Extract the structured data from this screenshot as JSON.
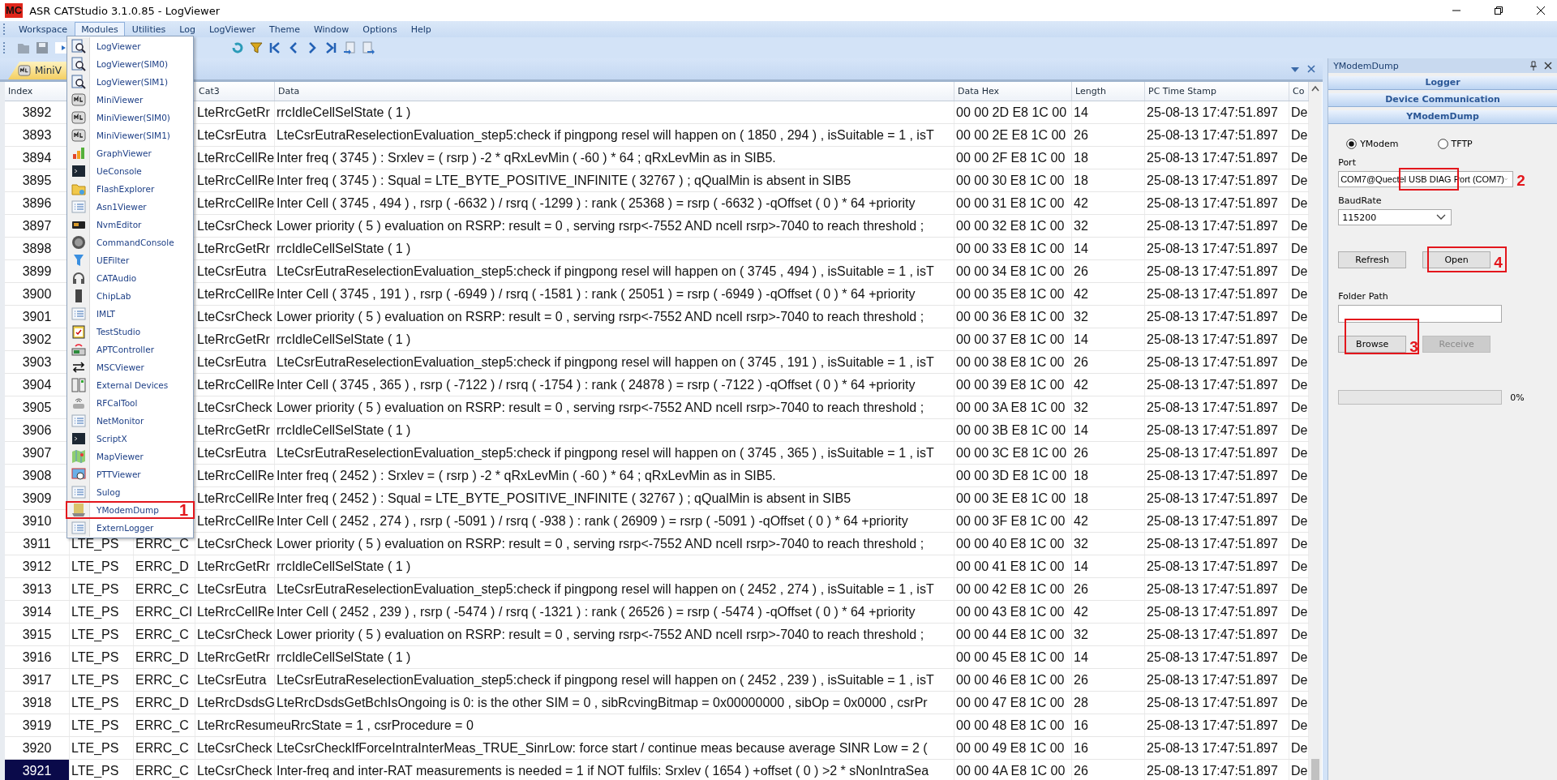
{
  "window": {
    "logo": "MC",
    "title": "ASR CATStudio 3.1.0.85 - LogViewer"
  },
  "menu_bar": [
    {
      "label": "Workspace",
      "selected": false
    },
    {
      "label": "Modules",
      "selected": true
    },
    {
      "label": "Utilities",
      "selected": false
    },
    {
      "label": "Log",
      "selected": false
    },
    {
      "label": "LogViewer",
      "selected": false
    },
    {
      "label": "Theme",
      "selected": false
    },
    {
      "label": "Window",
      "selected": false
    },
    {
      "label": "Options",
      "selected": false
    },
    {
      "label": "Help",
      "selected": false
    }
  ],
  "modules_menu": [
    {
      "label": "LogViewer"
    },
    {
      "label": "LogViewer(SIM0)"
    },
    {
      "label": "LogViewer(SIM1)"
    },
    {
      "label": "MiniViewer"
    },
    {
      "label": "MiniViewer(SIM0)"
    },
    {
      "label": "MiniViewer(SIM1)"
    },
    {
      "label": "GraphViewer"
    },
    {
      "label": "UeConsole"
    },
    {
      "label": "FlashExplorer"
    },
    {
      "label": "Asn1Viewer"
    },
    {
      "label": "NvmEditor"
    },
    {
      "label": "CommandConsole"
    },
    {
      "label": "UEFilter"
    },
    {
      "label": "CATAudio"
    },
    {
      "label": "ChipLab"
    },
    {
      "label": "IMLT"
    },
    {
      "label": "TestStudio"
    },
    {
      "label": "APTController"
    },
    {
      "label": "MSCViewer"
    },
    {
      "label": "External Devices"
    },
    {
      "label": "RFCalTool"
    },
    {
      "label": "NetMonitor"
    },
    {
      "label": "ScriptX"
    },
    {
      "label": "MapViewer"
    },
    {
      "label": "PTTViewer"
    },
    {
      "label": "Sulog"
    },
    {
      "label": "YModemDump",
      "callout": "1"
    },
    {
      "label": "ExternLogger"
    }
  ],
  "doc_tabs": [
    {
      "label": "MiniV",
      "selected": true
    }
  ],
  "log_table": {
    "columns": {
      "index": "Index",
      "cat3": "Cat3",
      "data": "Data",
      "data_hex": "Data Hex",
      "length": "Length",
      "pc_time_stamp": "PC Time Stamp",
      "column_9": "Co"
    },
    "rows": [
      {
        "index": "3892",
        "cat3": "LteRrcGetRr",
        "data": "rrcIdleCellSelState ( 1 )",
        "data_hex": "00 00 2D E8 1C 00",
        "length": "14",
        "pc_time_stamp": "25-08-13 17:47:51.897",
        "column_9": "De",
        "selected": false
      },
      {
        "index": "3893",
        "cat3": "LteCsrEutra",
        "data": "LteCsrEutraReselectionEvaluation_step5:check if pingpong resel will happen on ( 1850 , 294 ) , isSuitable = 1 , isT",
        "data_hex": "00 00 2E E8 1C 00",
        "length": "26",
        "pc_time_stamp": "25-08-13 17:47:51.897",
        "column_9": "De",
        "selected": false
      },
      {
        "index": "3894",
        "cat3": "LteRrcCellRe",
        "data": "Inter freq ( 3745 ) : Srxlev = ( rsrp ) -2 * qRxLevMin ( -60 ) * 64 ; qRxLevMin as in SIB5.",
        "data_hex": "00 00 2F E8 1C 00",
        "length": "18",
        "pc_time_stamp": "25-08-13 17:47:51.897",
        "column_9": "De",
        "selected": false
      },
      {
        "index": "3895",
        "cat3": "LteRrcCellRe",
        "data": "Inter freq ( 3745 ) : Squal = LTE_BYTE_POSITIVE_INFINITE ( 32767 ) ; qQualMin is absent in SIB5",
        "data_hex": "00 00 30 E8 1C 00",
        "length": "18",
        "pc_time_stamp": "25-08-13 17:47:51.897",
        "column_9": "De",
        "selected": false
      },
      {
        "index": "3896",
        "cat3": "LteRrcCellRe",
        "data": "Inter Cell ( 3745 , 494 ) , rsrp ( -6632 ) / rsrq ( -1299 ) : rank ( 25368 ) = rsrp ( -6632 ) -qOffset ( 0 ) * 64 +priority",
        "data_hex": "00 00 31 E8 1C 00",
        "length": "42",
        "pc_time_stamp": "25-08-13 17:47:51.897",
        "column_9": "De",
        "selected": false
      },
      {
        "index": "3897",
        "cat3": "LteCsrCheck",
        "data": "Lower priority ( 5 ) evaluation on RSRP: result = 0 , serving rsrp<-7552 AND ncell rsrp>-7040 to reach threshold ;",
        "data_hex": "00 00 32 E8 1C 00",
        "length": "32",
        "pc_time_stamp": "25-08-13 17:47:51.897",
        "column_9": "De",
        "selected": false
      },
      {
        "index": "3898",
        "cat3": "LteRrcGetRr",
        "data": "rrcIdleCellSelState ( 1 )",
        "data_hex": "00 00 33 E8 1C 00",
        "length": "14",
        "pc_time_stamp": "25-08-13 17:47:51.897",
        "column_9": "De",
        "selected": false
      },
      {
        "index": "3899",
        "cat3": "LteCsrEutra",
        "data": "LteCsrEutraReselectionEvaluation_step5:check if pingpong resel will happen on ( 3745 , 494 ) , isSuitable = 1 , isT",
        "data_hex": "00 00 34 E8 1C 00",
        "length": "26",
        "pc_time_stamp": "25-08-13 17:47:51.897",
        "column_9": "De",
        "selected": false
      },
      {
        "index": "3900",
        "cat3": "LteRrcCellRe",
        "data": "Inter Cell ( 3745 , 191 ) , rsrp ( -6949 ) / rsrq ( -1581 ) : rank ( 25051 ) = rsrp ( -6949 ) -qOffset ( 0 ) * 64 +priority",
        "data_hex": "00 00 35 E8 1C 00",
        "length": "42",
        "pc_time_stamp": "25-08-13 17:47:51.897",
        "column_9": "De",
        "selected": false
      },
      {
        "index": "3901",
        "cat3": "LteCsrCheck",
        "data": "Lower priority ( 5 ) evaluation on RSRP: result = 0 , serving rsrp<-7552 AND ncell rsrp>-7040 to reach threshold ;",
        "data_hex": "00 00 36 E8 1C 00",
        "length": "32",
        "pc_time_stamp": "25-08-13 17:47:51.897",
        "column_9": "De",
        "selected": false
      },
      {
        "index": "3902",
        "cat3": "LteRrcGetRr",
        "data": "rrcIdleCellSelState ( 1 )",
        "data_hex": "00 00 37 E8 1C 00",
        "length": "14",
        "pc_time_stamp": "25-08-13 17:47:51.897",
        "column_9": "De",
        "selected": false
      },
      {
        "index": "3903",
        "cat3": "LteCsrEutra",
        "data": "LteCsrEutraReselectionEvaluation_step5:check if pingpong resel will happen on ( 3745 , 191 ) , isSuitable = 1 , isT",
        "data_hex": "00 00 38 E8 1C 00",
        "length": "26",
        "pc_time_stamp": "25-08-13 17:47:51.897",
        "column_9": "De",
        "selected": false
      },
      {
        "index": "3904",
        "cat3": "LteRrcCellRe",
        "data": "Inter Cell ( 3745 , 365 ) , rsrp ( -7122 ) / rsrq ( -1754 ) : rank ( 24878 ) = rsrp ( -7122 ) -qOffset ( 0 ) * 64 +priority",
        "data_hex": "00 00 39 E8 1C 00",
        "length": "42",
        "pc_time_stamp": "25-08-13 17:47:51.897",
        "column_9": "De",
        "selected": false
      },
      {
        "index": "3905",
        "cat3": "LteCsrCheck",
        "data": "Lower priority ( 5 ) evaluation on RSRP: result = 0 , serving rsrp<-7552 AND ncell rsrp>-7040 to reach threshold ;",
        "data_hex": "00 00 3A E8 1C 00",
        "length": "32",
        "pc_time_stamp": "25-08-13 17:47:51.897",
        "column_9": "De",
        "selected": false
      },
      {
        "index": "3906",
        "cat3": "LteRrcGetRr",
        "data": "rrcIdleCellSelState ( 1 )",
        "data_hex": "00 00 3B E8 1C 00",
        "length": "14",
        "pc_time_stamp": "25-08-13 17:47:51.897",
        "column_9": "De",
        "selected": false
      },
      {
        "index": "3907",
        "cat3": "LteCsrEutra",
        "data": "LteCsrEutraReselectionEvaluation_step5:check if pingpong resel will happen on ( 3745 , 365 ) , isSuitable = 1 , isT",
        "data_hex": "00 00 3C E8 1C 00",
        "length": "26",
        "pc_time_stamp": "25-08-13 17:47:51.897",
        "column_9": "De",
        "selected": false
      },
      {
        "index": "3908",
        "cat3": "LteRrcCellRe",
        "data": "Inter freq ( 2452 ) : Srxlev = ( rsrp ) -2 * qRxLevMin ( -60 ) * 64 ; qRxLevMin as in SIB5.",
        "data_hex": "00 00 3D E8 1C 00",
        "length": "18",
        "pc_time_stamp": "25-08-13 17:47:51.897",
        "column_9": "De",
        "selected": false
      },
      {
        "index": "3909",
        "cat3": "LteRrcCellRe",
        "data": "Inter freq ( 2452 ) : Squal = LTE_BYTE_POSITIVE_INFINITE ( 32767 ) ; qQualMin is absent in SIB5",
        "data_hex": "00 00 3E E8 1C 00",
        "length": "18",
        "pc_time_stamp": "25-08-13 17:47:51.897",
        "column_9": "De",
        "selected": false
      },
      {
        "index": "3910",
        "cat3": "LteRrcCellRe",
        "data": "Inter Cell ( 2452 , 274 ) , rsrp ( -5091 ) / rsrq ( -938 ) : rank ( 26909 ) = rsrp ( -5091 ) -qOffset ( 0 ) * 64 +priority",
        "data_hex": "00 00 3F E8 1C 00",
        "length": "42",
        "pc_time_stamp": "25-08-13 17:47:51.897",
        "column_9": "De",
        "selected": false
      },
      {
        "index": "3911",
        "column_2": "LTE_PS",
        "column_3": "ERRC_C",
        "cat3": "LteCsrCheck",
        "data": "Lower priority ( 5 ) evaluation on RSRP: result = 0 , serving rsrp<-7552 AND ncell rsrp>-7040 to reach threshold ;",
        "data_hex": "00 00 40 E8 1C 00",
        "length": "32",
        "pc_time_stamp": "25-08-13 17:47:51.897",
        "column_9": "De",
        "selected": false
      },
      {
        "index": "3912",
        "column_2": "LTE_PS",
        "column_3": "ERRC_D",
        "cat3": "LteRrcGetRr",
        "data": "rrcIdleCellSelState ( 1 )",
        "data_hex": "00 00 41 E8 1C 00",
        "length": "14",
        "pc_time_stamp": "25-08-13 17:47:51.897",
        "column_9": "De",
        "selected": false
      },
      {
        "index": "3913",
        "column_2": "LTE_PS",
        "column_3": "ERRC_C",
        "cat3": "LteCsrEutra",
        "data": "LteCsrEutraReselectionEvaluation_step5:check if pingpong resel will happen on ( 2452 , 274 ) , isSuitable = 1 , isT",
        "data_hex": "00 00 42 E8 1C 00",
        "length": "26",
        "pc_time_stamp": "25-08-13 17:47:51.897",
        "column_9": "De",
        "selected": false
      },
      {
        "index": "3914",
        "column_2": "LTE_PS",
        "column_3": "ERRC_CI",
        "cat3": "LteRrcCellRe",
        "data": "Inter Cell ( 2452 , 239 ) , rsrp ( -5474 ) / rsrq ( -1321 ) : rank ( 26526 ) = rsrp ( -5474 ) -qOffset ( 0 ) * 64 +priority",
        "data_hex": "00 00 43 E8 1C 00",
        "length": "42",
        "pc_time_stamp": "25-08-13 17:47:51.897",
        "column_9": "De",
        "selected": false
      },
      {
        "index": "3915",
        "column_2": "LTE_PS",
        "column_3": "ERRC_C",
        "cat3": "LteCsrCheck",
        "data": "Lower priority ( 5 ) evaluation on RSRP: result = 0 , serving rsrp<-7552 AND ncell rsrp>-7040 to reach threshold ;",
        "data_hex": "00 00 44 E8 1C 00",
        "length": "32",
        "pc_time_stamp": "25-08-13 17:47:51.897",
        "column_9": "De",
        "selected": false
      },
      {
        "index": "3916",
        "column_2": "LTE_PS",
        "column_3": "ERRC_D",
        "cat3": "LteRrcGetRr",
        "data": "rrcIdleCellSelState ( 1 )",
        "data_hex": "00 00 45 E8 1C 00",
        "length": "14",
        "pc_time_stamp": "25-08-13 17:47:51.897",
        "column_9": "De",
        "selected": false
      },
      {
        "index": "3917",
        "column_2": "LTE_PS",
        "column_3": "ERRC_C",
        "cat3": "LteCsrEutra",
        "data": "LteCsrEutraReselectionEvaluation_step5:check if pingpong resel will happen on ( 2452 , 239 ) , isSuitable = 1 , isT",
        "data_hex": "00 00 46 E8 1C 00",
        "length": "26",
        "pc_time_stamp": "25-08-13 17:47:51.897",
        "column_9": "De",
        "selected": false
      },
      {
        "index": "3918",
        "column_2": "LTE_PS",
        "column_3": "ERRC_D",
        "cat3": "LteRrcDsdsG",
        "data": "LteRrcDsdsGetBchIsOngoing is 0: is the other SIM = 0 , sibRcvingBitmap = 0x00000000 , sibOp = 0x0000 , csrPr",
        "data_hex": "00 00 47 E8 1C 00",
        "length": "28",
        "pc_time_stamp": "25-08-13 17:47:51.897",
        "column_9": "De",
        "selected": false
      },
      {
        "index": "3919",
        "column_2": "LTE_PS",
        "column_3": "ERRC_C",
        "cat3": "LteRrcResum",
        "data": "euRrcState = 1 , csrProcedure = 0",
        "data_hex": "00 00 48 E8 1C 00",
        "length": "16",
        "pc_time_stamp": "25-08-13 17:47:51.897",
        "column_9": "De",
        "selected": false
      },
      {
        "index": "3920",
        "column_2": "LTE_PS",
        "column_3": "ERRC_C",
        "cat3": "LteCsrCheck",
        "data": "LteCsrCheckIfForceIntraInterMeas_TRUE_SinrLow: force start / continue meas because average SINR Low = 2 (",
        "data_hex": "00 00 49 E8 1C 00",
        "length": "16",
        "pc_time_stamp": "25-08-13 17:47:51.897",
        "column_9": "De",
        "selected": false
      },
      {
        "index": "3921",
        "column_2": "LTE_PS",
        "column_3": "ERRC_C",
        "cat3": "LteCsrCheck",
        "data": "Inter-freq and inter-RAT measurements is needed = 1 if NOT fulfils: Srxlev ( 1654 ) +offset ( 0 ) >2 * sNonIntraSea",
        "data_hex": "00 00 4A E8 1C 00",
        "length": "26",
        "pc_time_stamp": "25-08-13 17:47:51.897",
        "column_9": "De",
        "selected": true
      }
    ]
  },
  "tool_panel": {
    "title": "YModemDump",
    "sections": [
      "Logger",
      "Device Communication",
      "YModemDump"
    ],
    "protocols": [
      {
        "label": "YModem",
        "selected": true
      },
      {
        "label": "TFTP",
        "selected": false
      }
    ],
    "port": {
      "label": "Port",
      "value": "COM7@Quectel USB DIAG Port (COM7)",
      "callout": "2"
    },
    "baud_rate": {
      "label": "BaudRate",
      "value": "115200"
    },
    "connection_buttons": [
      {
        "label": "Refresh",
        "disabled": false
      },
      {
        "label": "Open",
        "disabled": false,
        "callout": "4"
      }
    ],
    "folder_path": {
      "label": "Folder Path"
    },
    "transfer_buttons": [
      {
        "label": "Browse",
        "disabled": false,
        "callout": "3"
      },
      {
        "label": "Receive",
        "disabled": true
      }
    ],
    "progress": {
      "level": 0,
      "reading": "0%"
    }
  }
}
